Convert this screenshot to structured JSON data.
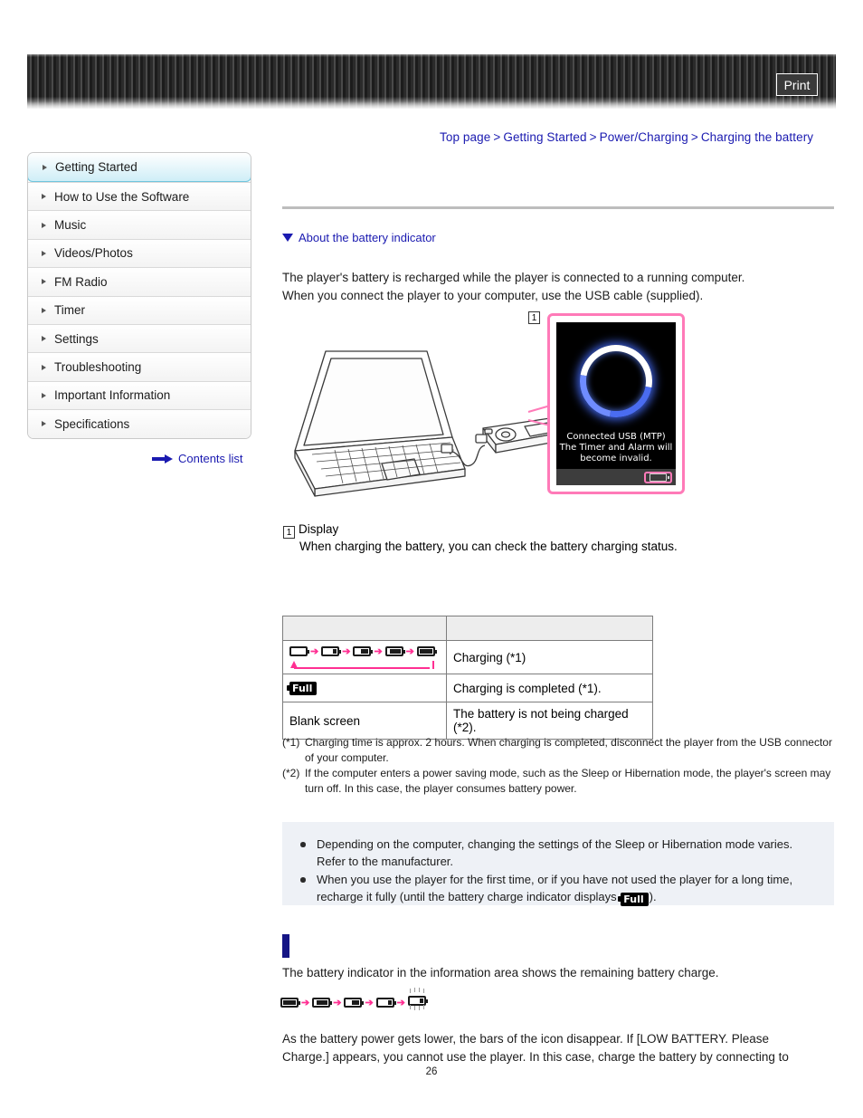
{
  "header": {
    "print_label": "Print"
  },
  "breadcrumb": {
    "items": [
      "Top page",
      "Getting Started",
      "Power/Charging",
      "Charging the battery"
    ],
    "separator": ">"
  },
  "sidebar": {
    "items": [
      {
        "label": "Getting Started",
        "active": true
      },
      {
        "label": "How to Use the Software",
        "active": false
      },
      {
        "label": "Music",
        "active": false
      },
      {
        "label": "Videos/Photos",
        "active": false
      },
      {
        "label": "FM Radio",
        "active": false
      },
      {
        "label": "Timer",
        "active": false
      },
      {
        "label": "Settings",
        "active": false
      },
      {
        "label": "Troubleshooting",
        "active": false
      },
      {
        "label": "Important Information",
        "active": false
      },
      {
        "label": "Specifications",
        "active": false
      }
    ],
    "contents_list_label": "Contents list"
  },
  "main": {
    "anchor_link": "About the battery indicator",
    "intro_line1": "The player's battery is recharged while the player is connected to a running computer.",
    "intro_line2": "When you connect the player to your computer, use the USB cable (supplied).",
    "illustration": {
      "callout_number": "1",
      "screen_text_line1": "Connected USB (MTP)",
      "screen_text_line2": "The Timer and Alarm will",
      "screen_text_line3": "become invalid."
    },
    "display_caption": {
      "number": "1",
      "title": "Display",
      "description": "When charging the battery, you can check the battery charging status."
    },
    "status_table": {
      "header": [
        "",
        ""
      ],
      "rows": [
        {
          "indicator_type": "charging-animation",
          "indicator_text": "",
          "description": "Charging (*1)"
        },
        {
          "indicator_type": "full-badge",
          "indicator_text": "Full",
          "description": "Charging is completed (*1)."
        },
        {
          "indicator_type": "text",
          "indicator_text": "Blank screen",
          "description": "The battery is not being charged (*2)."
        }
      ]
    },
    "footnotes": [
      {
        "mark": "(*1)",
        "text": "Charging time is approx. 2 hours. When charging is completed, disconnect the player from the USB connector of your computer."
      },
      {
        "mark": "(*2)",
        "text": "If the computer enters a power saving mode, such as the Sleep or Hibernation mode, the player's screen may turn off. In this case, the player consumes battery power."
      }
    ],
    "notes": [
      {
        "text": "Depending on the computer, changing the settings of the Sleep or Hibernation mode varies. Refer to the manufacturer."
      },
      {
        "text_before": "When you use the player for the first time, or if you have not used the player for a long time, recharge it fully (until the battery charge indicator displays ",
        "badge": "Full",
        "text_after": ")."
      }
    ],
    "battery_section": {
      "heading": "",
      "paragraph": "The battery indicator in the information area shows the remaining battery charge.",
      "closing_line1": "As the battery power gets lower, the bars of the icon disappear. If [LOW BATTERY. Please",
      "closing_line2": "Charge.] appears, you cannot use the player. In this case, charge the battery by connecting to"
    }
  },
  "footer": {
    "page_number": "26"
  },
  "colors": {
    "link": "#1a1ab0",
    "accent_pink": "#ff2f92",
    "callout_pink": "#ff7ab8",
    "section_bar": "#151585",
    "note_bg": "#eef1f6",
    "active_nav": "#cfeef7"
  }
}
